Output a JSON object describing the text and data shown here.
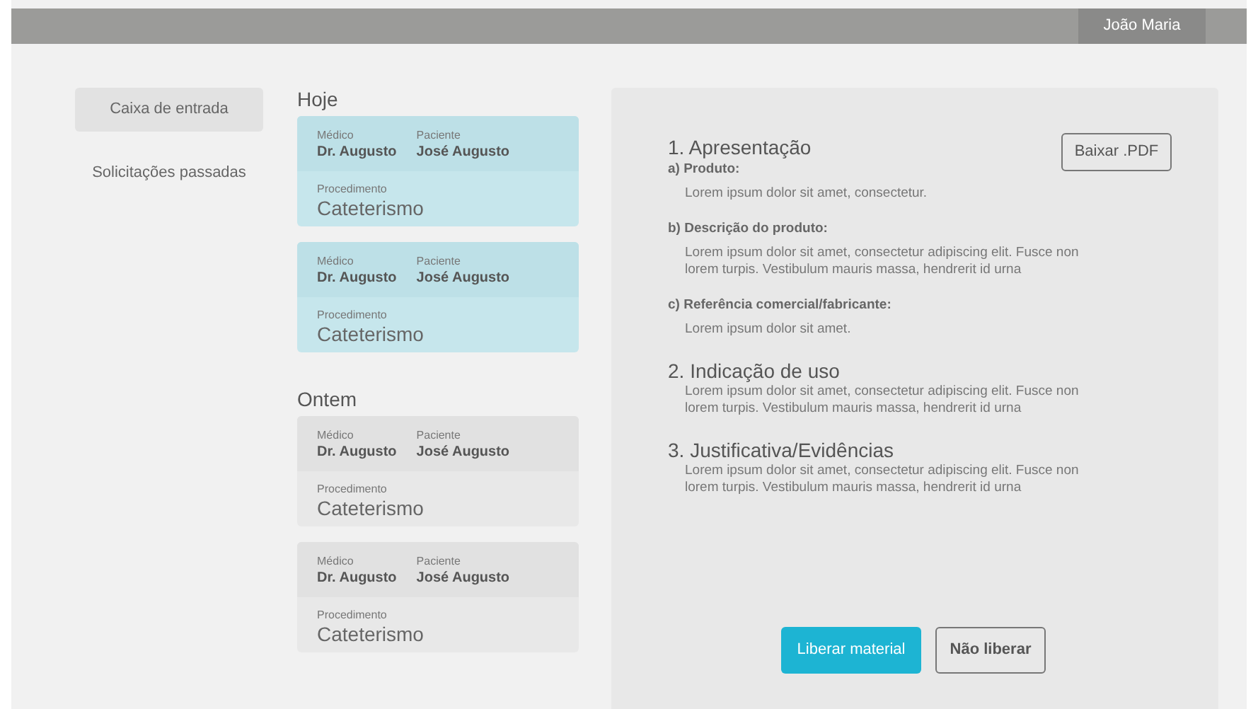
{
  "top_bar": {
    "user": "João Maria"
  },
  "sidebar": {
    "items": [
      {
        "label": "Caixa de entrada",
        "selected": true
      },
      {
        "label": "Solicitações passadas",
        "selected": false
      }
    ]
  },
  "groups": [
    {
      "title": "Hoje",
      "cards": [
        {
          "unread": true,
          "doctor_label": "Médico",
          "doctor": "Dr. Augusto",
          "patient_label": "Paciente",
          "patient": "José Augusto",
          "procedure_label": "Procedimento",
          "procedure": "Cateterismo"
        },
        {
          "unread": true,
          "doctor_label": "Médico",
          "doctor": "Dr. Augusto",
          "patient_label": "Paciente",
          "patient": "José Augusto",
          "procedure_label": "Procedimento",
          "procedure": "Cateterismo"
        }
      ]
    },
    {
      "title": "Ontem",
      "cards": [
        {
          "unread": false,
          "doctor_label": "Médico",
          "doctor": "Dr. Augusto",
          "patient_label": "Paciente",
          "patient": "José Augusto",
          "procedure_label": "Procedimento",
          "procedure": "Cateterismo"
        },
        {
          "unread": false,
          "doctor_label": "Médico",
          "doctor": "Dr. Augusto",
          "patient_label": "Paciente",
          "patient": "José Augusto",
          "procedure_label": "Procedimento",
          "procedure": "Cateterismo"
        }
      ]
    }
  ],
  "detail": {
    "download_button": "Baixar .PDF",
    "sections": [
      {
        "title": "1. Apresentação",
        "subsections": [
          {
            "label": "a) Produto:",
            "text": "Lorem ipsum dolor sit amet, consectetur."
          },
          {
            "label": "b) Descrição do produto:",
            "text": "Lorem ipsum dolor sit amet, consectetur adipiscing elit. Fusce non lorem turpis. Vestibulum mauris massa, hendrerit id urna"
          },
          {
            "label": "c) Referência comercial/fabricante:",
            "text": "Lorem ipsum dolor sit amet."
          }
        ]
      },
      {
        "title": "2. Indicação de uso",
        "text": "Lorem ipsum dolor sit amet, consectetur adipiscing elit. Fusce non lorem turpis. Vestibulum mauris massa, hendrerit id urna"
      },
      {
        "title": "3. Justificativa/Evidências",
        "text": "Lorem ipsum dolor sit amet, consectetur adipiscing elit. Fusce non lorem turpis. Vestibulum mauris massa, hendrerit id urna"
      }
    ],
    "approve_button": "Liberar material",
    "reject_button": "Não liberar"
  }
}
